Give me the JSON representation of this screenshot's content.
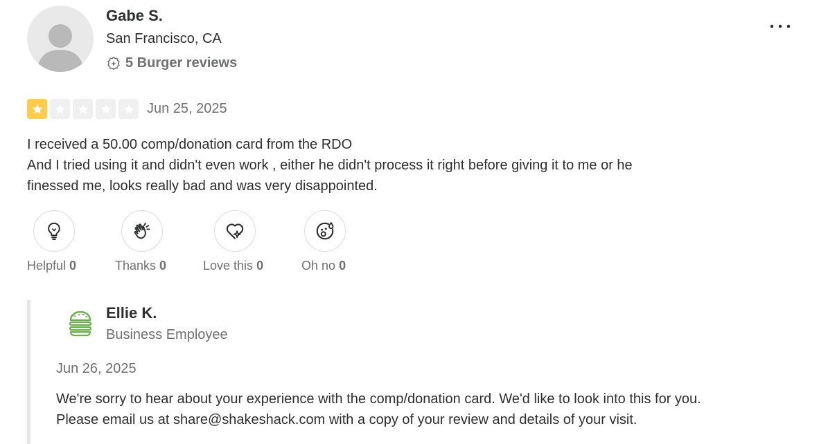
{
  "reviewer": {
    "name": "Gabe S.",
    "location": "San Francisco, CA",
    "reviews_label": "5 Burger reviews"
  },
  "review": {
    "rating": 1,
    "max_rating": 5,
    "date": "Jun 25, 2025",
    "lines": [
      "I received a 50.00 comp/donation card from the RDO",
      "And I tried using it and didn't even work , either he didn't process it right before giving it to me or he",
      "finessed me, looks really bad and was very disappointed."
    ]
  },
  "reactions": [
    {
      "label": "Helpful",
      "count": "0",
      "icon": "lightbulb-icon"
    },
    {
      "label": "Thanks",
      "count": "0",
      "icon": "clapping-hands-icon"
    },
    {
      "label": "Love this",
      "count": "0",
      "icon": "heart-icon"
    },
    {
      "label": "Oh no",
      "count": "0",
      "icon": "surprised-face-icon"
    }
  ],
  "reply": {
    "name": "Ellie K.",
    "role": "Business Employee",
    "date": "Jun 26, 2025",
    "lines": [
      "We're sorry to hear about your experience with the comp/donation card. We'd like to look into this for you.",
      "Please email us at share@shakeshack.com with a copy of your review and details of your visit."
    ]
  },
  "colors": {
    "star_filled": "#ffcc4b",
    "star_empty": "#f0f0f0",
    "brand_green": "#6aaf4e",
    "muted_text": "#6e7072"
  },
  "icons": {
    "more": "more-options-icon",
    "badge": "badge-icon",
    "star": "star-icon",
    "business_logo": "burger-logo-icon"
  }
}
